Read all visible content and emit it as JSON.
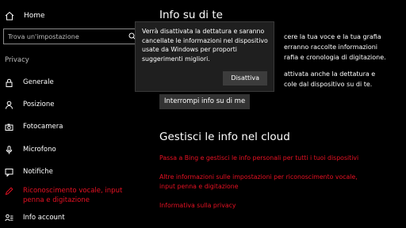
{
  "sidebar": {
    "home_label": "Home",
    "search_placeholder": "Trova un'impostazione",
    "section_label": "Privacy",
    "items": [
      {
        "label": "Generale",
        "icon": "lock-icon"
      },
      {
        "label": "Posizione",
        "icon": "person-location-icon"
      },
      {
        "label": "Fotocamera",
        "icon": "camera-icon"
      },
      {
        "label": "Microfono",
        "icon": "microphone-icon"
      },
      {
        "label": "Notifiche",
        "icon": "notification-icon"
      },
      {
        "label": "Riconoscimento vocale, input penna e digitazione",
        "icon": "pen-icon",
        "active": true
      },
      {
        "label": "Info account",
        "icon": "account-icon"
      }
    ]
  },
  "main": {
    "title": "Info su di te",
    "para1": [
      "cere la tua voce e la tua grafia",
      "erranno raccolte informazioni",
      "rafia e cronologia di digitazione."
    ],
    "para2": [
      "attivata anche la dettatura e",
      "cole dal dispositivo su di te."
    ],
    "stop_button": "Interrompi info su di me",
    "cloud_title": "Gestisci le info nel cloud",
    "links": [
      "Passa a Bing e gestisci le info personali per tutti i tuoi dispositivi",
      "Altre informazioni sulle impostazioni per riconoscimento vocale, input penna e digitazione",
      "Informativa sulla privacy"
    ]
  },
  "popup": {
    "message": "Verrà disattivata la dettatura e saranno cancellate le informazioni nel dispositivo usate da Windows per proporti suggerimenti migliori.",
    "button": "Disattiva"
  },
  "colors": {
    "accent": "#e81123",
    "background": "#000000",
    "popup_bg": "#1f1f1f"
  }
}
